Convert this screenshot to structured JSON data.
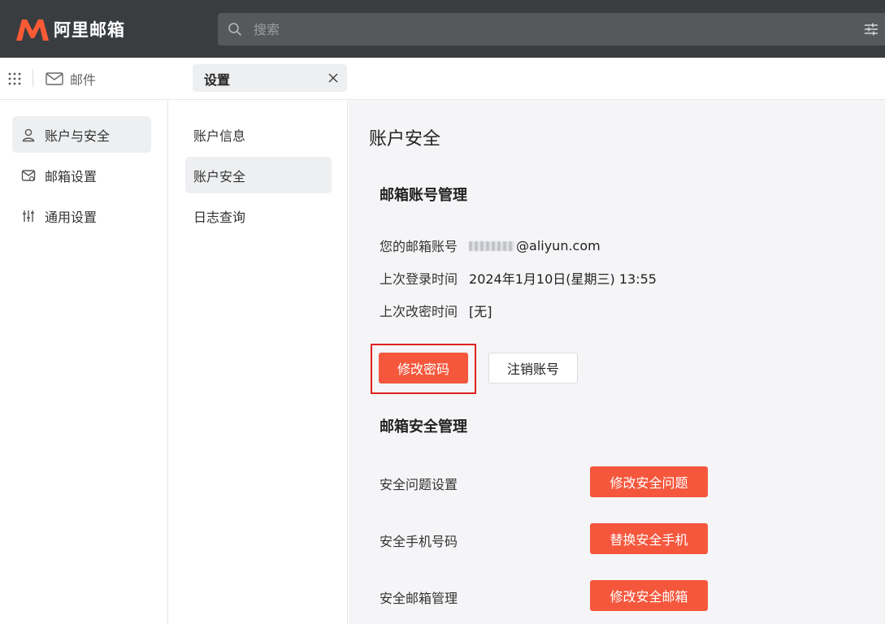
{
  "app": {
    "name": "阿里邮箱"
  },
  "search": {
    "placeholder": "搜索"
  },
  "tabs": {
    "mail_label": "邮件",
    "settings_label": "设置"
  },
  "leftnav": {
    "items": [
      {
        "label": "账户与安全",
        "icon": "user-icon",
        "active": true
      },
      {
        "label": "邮箱设置",
        "icon": "mailbox-settings-icon",
        "active": false
      },
      {
        "label": "通用设置",
        "icon": "sliders-icon",
        "active": false
      }
    ]
  },
  "subnav": {
    "items": [
      {
        "label": "账户信息",
        "active": false
      },
      {
        "label": "账户安全",
        "active": true
      },
      {
        "label": "日志查询",
        "active": false
      }
    ]
  },
  "main": {
    "title": "账户安全",
    "account_section": {
      "title": "邮箱账号管理",
      "email_label": "您的邮箱账号",
      "email_domain": "@aliyun.com",
      "last_login_label": "上次登录时间",
      "last_login_value": "2024年1月10日(星期三) 13:55",
      "last_pwd_change_label": "上次改密时间",
      "last_pwd_change_value": "[无]",
      "change_password_button": "修改密码",
      "cancel_account_button": "注销账号"
    },
    "security_section": {
      "title": "邮箱安全管理",
      "rows": [
        {
          "label": "安全问题设置",
          "button": "修改安全问题"
        },
        {
          "label": "安全手机号码",
          "button": "替换安全手机"
        },
        {
          "label": "安全邮箱管理",
          "button": "修改安全邮箱"
        }
      ]
    }
  },
  "colors": {
    "topbar": "#3a3d40",
    "accent": "#f5573d",
    "highlight_border": "#e02020",
    "active_bg": "#eeeff1",
    "main_bg": "#f5f5f7"
  }
}
